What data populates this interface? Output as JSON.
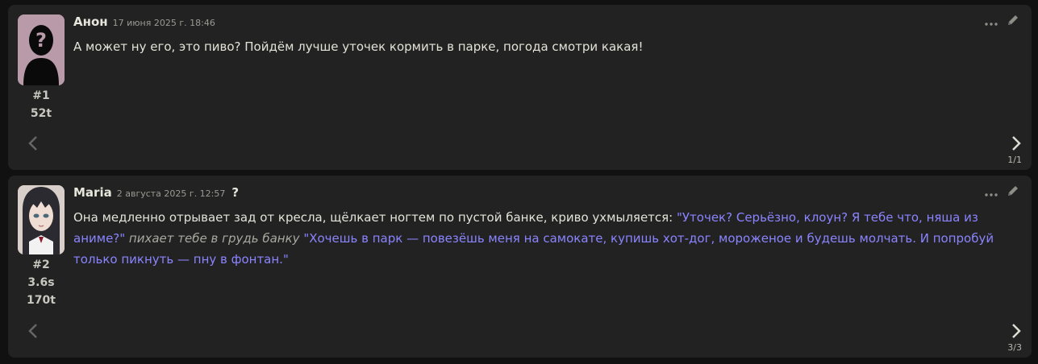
{
  "messages": [
    {
      "author": "Анон",
      "date": "17 июня 2025 г. 18:46",
      "id_label": "#1",
      "stats": [
        "52t"
      ],
      "text": "А может ну его, это пиво? Пойдём лучше уточек кормить в парке, погода смотри какая!",
      "swipe_counter": "1/1"
    },
    {
      "author": "Maria",
      "date": "2 августа 2025 г. 12:57",
      "question_mark": "?",
      "id_label": "#2",
      "stats": [
        "3.6s",
        "170t"
      ],
      "segments": [
        {
          "type": "plain",
          "text": "Она медленно отрывает зад от кресла, щёлкает ногтем по пустой банке, криво ухмыляется: "
        },
        {
          "type": "quote",
          "text": "\"Уточек? Серьёзно, клоун? Я тебе что, няша из аниме?\""
        },
        {
          "type": "em",
          "text": " пихает тебе в грудь банку "
        },
        {
          "type": "quote",
          "text": "\"Хочешь в парк — повезёшь меня на самокате, купишь хот-дог, мороженое и будешь молчать. И попробуй только пикнуть — пну в фонтан.\""
        }
      ],
      "swipe_counter": "3/3"
    }
  ],
  "icons": {
    "more": "more-horizontal-icon",
    "edit": "pencil-icon",
    "swipe_left": "chevron-left-icon",
    "swipe_right": "chevron-right-icon"
  },
  "colors": {
    "background": "#111111",
    "message_bg": "#222222",
    "quote": "#8a84ff",
    "text": "#e2e2d8"
  }
}
